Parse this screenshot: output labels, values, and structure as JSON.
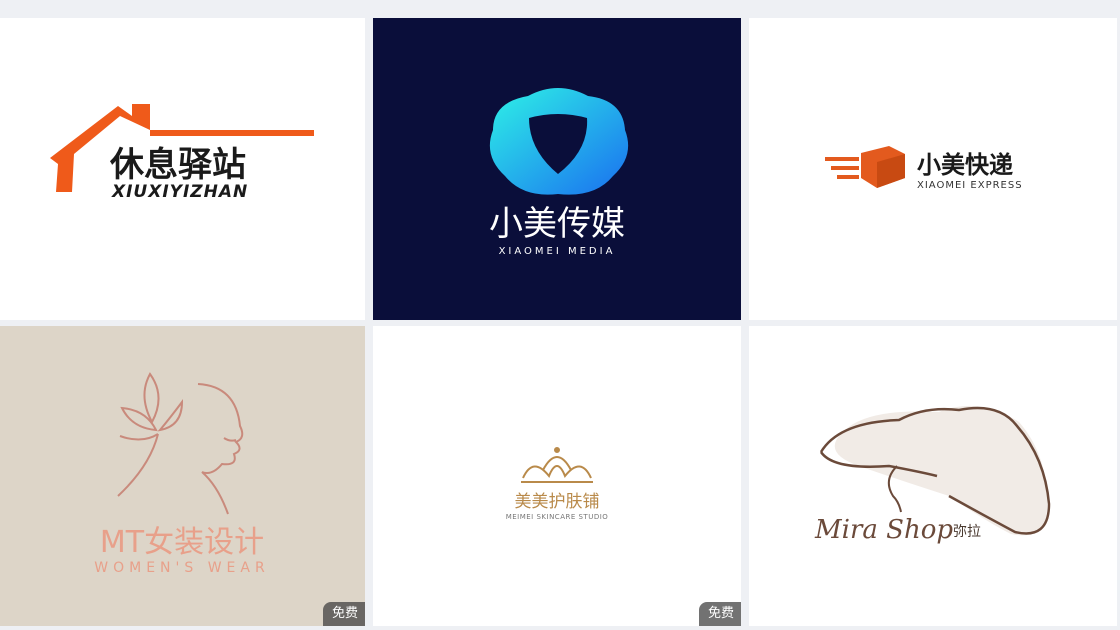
{
  "cards": [
    {
      "title": "休息驿站",
      "subtitle": "XIUXIYIZHAN",
      "icon": "house-roof-icon",
      "accent": "#ef5a1a"
    },
    {
      "title": "小美传媒",
      "subtitle": "XIAOMEI MEDIA",
      "icon": "shield-ribbon-icon",
      "accent": "#1fd1e8",
      "background": "#0a0e3a"
    },
    {
      "title": "小美快递",
      "subtitle": "XIAOMEI EXPRESS",
      "icon": "flying-box-icon",
      "accent": "#e35a1e"
    },
    {
      "title": "MT女装设计",
      "subtitle": "WOMEN'S WEAR",
      "icon": "flower-face-icon",
      "accent": "#e8a08a",
      "background": "#ddd5c8",
      "badge": "免费"
    },
    {
      "title": "美美护肤铺",
      "subtitle": "MEIMEI SKINCARE STUDIO",
      "icon": "crown-icon",
      "accent": "#b98a4a",
      "badge": "免费"
    },
    {
      "title": "Mira Shop",
      "subtitle": "弥拉",
      "icon": "hat-lady-icon",
      "accent": "#6b4a3a"
    }
  ]
}
